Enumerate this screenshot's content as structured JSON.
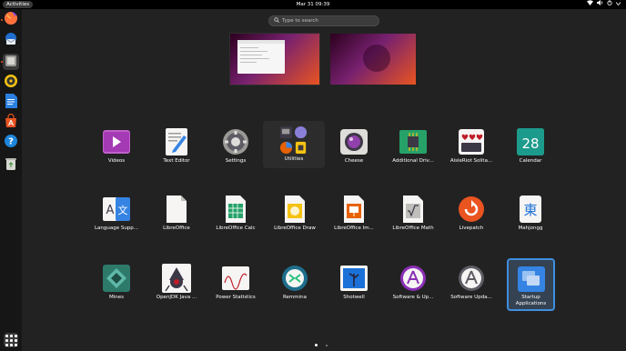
{
  "topbar": {
    "activities": "Activities",
    "clock": "Mar 31  09:39",
    "tray_icons": [
      "network-icon",
      "volume-icon",
      "power-icon",
      "menu-arrow-icon"
    ]
  },
  "dock": {
    "items": [
      {
        "name": "firefox",
        "icon": "firefox-icon"
      },
      {
        "name": "thunderbird",
        "icon": "mail-icon"
      },
      {
        "name": "files",
        "icon": "files-icon"
      },
      {
        "name": "rhythmbox",
        "icon": "music-icon"
      },
      {
        "name": "writer",
        "icon": "writer-icon"
      },
      {
        "name": "software",
        "icon": "software-store-icon"
      },
      {
        "name": "help",
        "icon": "help-icon"
      },
      {
        "name": "trash",
        "icon": "trash-icon"
      }
    ],
    "show_apps_icon": "grid-icon"
  },
  "search": {
    "placeholder": "Type to search"
  },
  "apps": [
    {
      "label": "Videos",
      "icon": "videos-icon"
    },
    {
      "label": "Text Editor",
      "icon": "text-editor-icon"
    },
    {
      "label": "Settings",
      "icon": "settings-icon"
    },
    {
      "label": "Utilities",
      "icon": "utilities-folder-icon"
    },
    {
      "label": "Cheese",
      "icon": "cheese-icon"
    },
    {
      "label": "Additional Driv...",
      "icon": "chip-icon"
    },
    {
      "label": "AisleRiot Solita...",
      "icon": "cards-icon"
    },
    {
      "label": "Calendar",
      "icon": "calendar-icon",
      "day": "28"
    },
    {
      "label": "Language Supp...",
      "icon": "language-icon"
    },
    {
      "label": "LibreOffice",
      "icon": "libreoffice-icon"
    },
    {
      "label": "LibreOffice Calc",
      "icon": "calc-icon"
    },
    {
      "label": "LibreOffice Draw",
      "icon": "draw-icon"
    },
    {
      "label": "LibreOffice Im...",
      "icon": "impress-icon"
    },
    {
      "label": "LibreOffice Math",
      "icon": "math-icon"
    },
    {
      "label": "Livepatch",
      "icon": "livepatch-icon"
    },
    {
      "label": "Mahjongg",
      "icon": "mahjongg-icon"
    },
    {
      "label": "Mines",
      "icon": "mines-icon"
    },
    {
      "label": "OpenJDK Java ...",
      "icon": "java-icon"
    },
    {
      "label": "Power Statistics",
      "icon": "power-stats-icon"
    },
    {
      "label": "Remmina",
      "icon": "remmina-icon"
    },
    {
      "label": "Shotwell",
      "icon": "shotwell-icon"
    },
    {
      "label": "Software & Up...",
      "icon": "software-updates-icon"
    },
    {
      "label": "Software Upda...",
      "icon": "software-updater-icon"
    },
    {
      "label": "Startup Applications",
      "icon": "startup-apps-icon"
    }
  ],
  "colors": {
    "accent": "#e95420",
    "selection": "#3f8ee0"
  }
}
